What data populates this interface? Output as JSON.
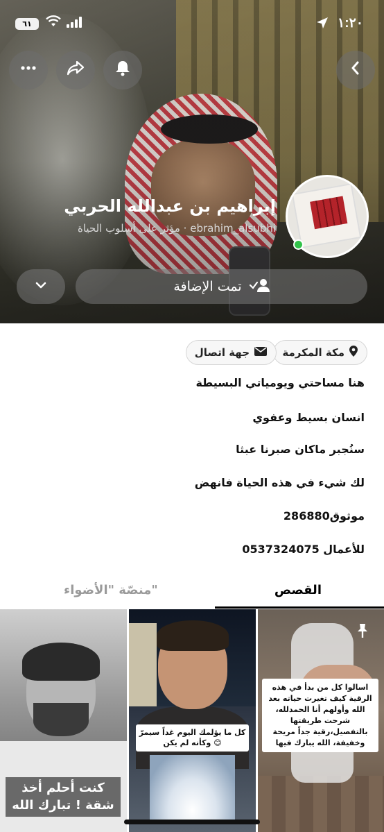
{
  "status_bar": {
    "time": "١:٢٠",
    "battery": "٦١"
  },
  "header": {
    "buttons": {
      "back": "back",
      "notifications": "bell",
      "share": "share",
      "more": "more"
    }
  },
  "profile": {
    "display_name": "إبراهيم بن عبدالله الحربي",
    "username": "ebrahim_alsubhi",
    "separator": "·",
    "category": "مؤثر على أسلوب الحياة",
    "added_label": "تمت الإضافة",
    "location_chip": "مكة المكرمة",
    "contact_chip": "جهة اتصال",
    "bio": [
      "هنا مساحتي ويومياتي البسيطة",
      "انسان بسيط وعفوي",
      "سنُجبر ماكان صبرنا عبثا",
      "لك شيء في هذه الحياة فانهض",
      "موثوق286880",
      "للأعمال 0537324075"
    ]
  },
  "tabs": [
    {
      "label": "القصص",
      "active": true
    },
    {
      "label": "منصّة \"الأضواء\"",
      "active": false
    }
  ],
  "stories": [
    {
      "caption": "كنت أحلم أخذ شقة ! تبارك الله"
    },
    {
      "caption": "كل ما يؤلمك اليوم غداً سيمرّ وكأنه لم يكن 😊"
    },
    {
      "caption": "اسالوا كل من بدأ في هذه الرقية كيف تغيرت حياته بعد الله وأولهم أنا الحمدلله، شرحت طريقتها بالتفصيل،رقية جداً مريحة وخفيفة، الله يبارك فيها"
    }
  ],
  "colors": {
    "online": "#32c24a",
    "tab_active": "#000000",
    "tab_inactive": "#9a9a9a"
  }
}
